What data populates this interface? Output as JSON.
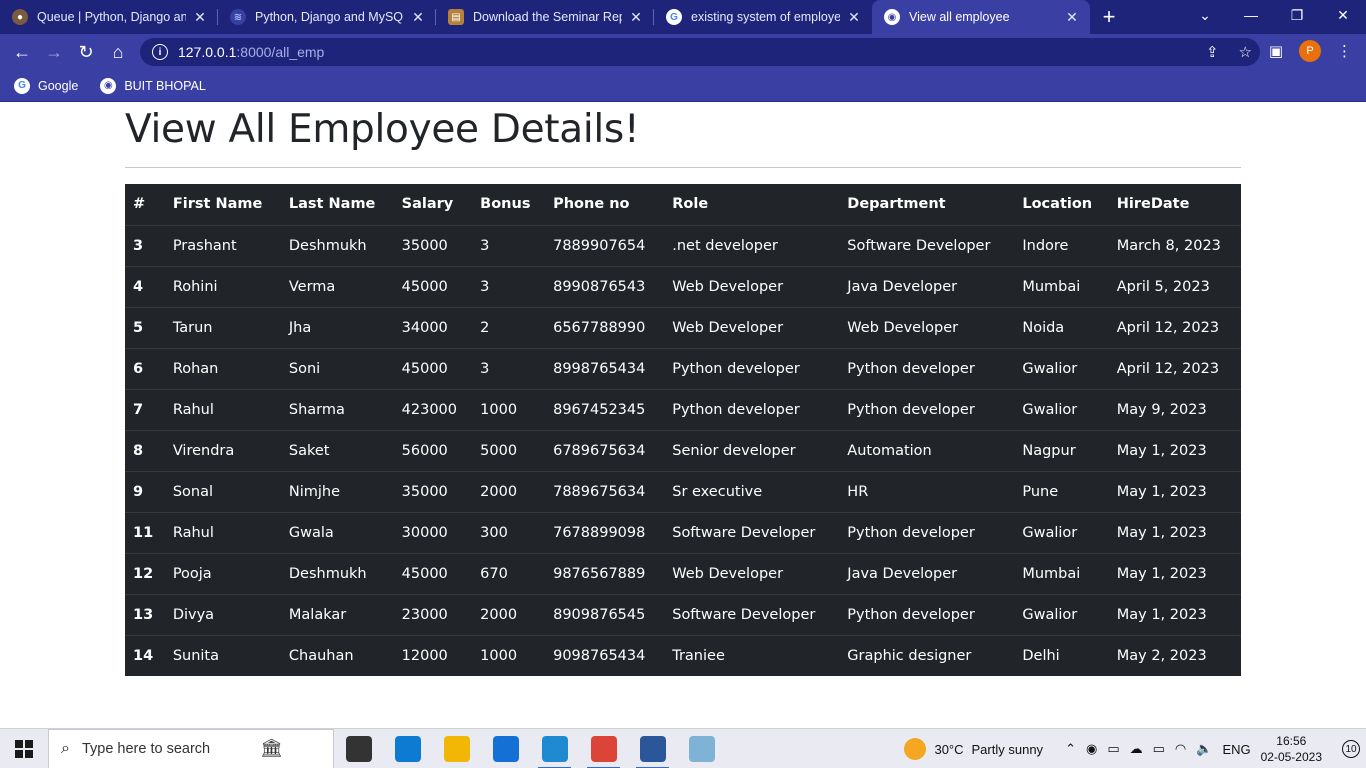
{
  "browser": {
    "tabs": [
      {
        "title": "Queue | Python, Django and",
        "favicon": "anaconda-icon",
        "color": "#5a4a3a",
        "active": false
      },
      {
        "title": "Python, Django and MySQL F",
        "favicon": "stripes-icon",
        "color": "#6c8ebf",
        "active": false
      },
      {
        "title": "Download the Seminar Repor",
        "favicon": "report-icon",
        "color": "#b4823c",
        "active": false
      },
      {
        "title": "existing system of employee",
        "favicon": "google-icon",
        "color": "#ffffff",
        "active": false
      },
      {
        "title": "View all employee",
        "favicon": "globe-icon",
        "color": "#ffffff",
        "active": true
      }
    ],
    "new_tab_label": "+",
    "address": {
      "host": "127.0.0.1",
      "path": ":8000/all_emp"
    },
    "profile_initial": "P",
    "bookmarks": [
      {
        "label": "Google",
        "icon": "google-icon"
      },
      {
        "label": "BUIT BHOPAL",
        "icon": "globe-icon"
      }
    ]
  },
  "page": {
    "heading": "View All Employee Details!"
  },
  "table": {
    "headers": [
      "#",
      "First Name",
      "Last Name",
      "Salary",
      "Bonus",
      "Phone no",
      "Role",
      "Department",
      "Location",
      "HireDate"
    ],
    "rows": [
      [
        "3",
        "Prashant",
        "Deshmukh",
        "35000",
        "3",
        "7889907654",
        ".net developer",
        "Software Developer",
        "Indore",
        "March 8, 2023"
      ],
      [
        "4",
        "Rohini",
        "Verma",
        "45000",
        "3",
        "8990876543",
        "Web Developer",
        "Java Developer",
        "Mumbai",
        "April 5, 2023"
      ],
      [
        "5",
        "Tarun",
        "Jha",
        "34000",
        "2",
        "6567788990",
        "Web Developer",
        "Web Developer",
        "Noida",
        "April 12, 2023"
      ],
      [
        "6",
        "Rohan",
        "Soni",
        "45000",
        "3",
        "8998765434",
        "Python developer",
        "Python developer",
        "Gwalior",
        "April 12, 2023"
      ],
      [
        "7",
        "Rahul",
        "Sharma",
        "423000",
        "1000",
        "8967452345",
        "Python developer",
        "Python developer",
        "Gwalior",
        "May 9, 2023"
      ],
      [
        "8",
        "Virendra",
        "Saket",
        "56000",
        "5000",
        "6789675634",
        "Senior developer",
        "Automation",
        "Nagpur",
        "May 1, 2023"
      ],
      [
        "9",
        "Sonal",
        "Nimjhe",
        "35000",
        "2000",
        "7889675634",
        "Sr executive",
        "HR",
        "Pune",
        "May 1, 2023"
      ],
      [
        "11",
        "Rahul",
        "Gwala",
        "30000",
        "300",
        "7678899098",
        "Software Developer",
        "Python developer",
        "Gwalior",
        "May 1, 2023"
      ],
      [
        "12",
        "Pooja",
        "Deshmukh",
        "45000",
        "670",
        "9876567889",
        "Web Developer",
        "Java Developer",
        "Mumbai",
        "May 1, 2023"
      ],
      [
        "13",
        "Divya",
        "Malakar",
        "23000",
        "2000",
        "8909876545",
        "Software Developer",
        "Python developer",
        "Gwalior",
        "May 1, 2023"
      ],
      [
        "14",
        "Sunita",
        "Chauhan",
        "12000",
        "1000",
        "9098765434",
        "Traniee",
        "Graphic designer",
        "Delhi",
        "May 2, 2023"
      ]
    ]
  },
  "taskbar": {
    "search_placeholder": "Type here to search",
    "apps": [
      {
        "name": "task-view-icon",
        "color": "#333333",
        "open": false
      },
      {
        "name": "edge-icon",
        "color": "#0c7bd1",
        "open": false
      },
      {
        "name": "file-explorer-icon",
        "color": "#f2b705",
        "open": false
      },
      {
        "name": "mail-icon",
        "color": "#1570d6",
        "open": false
      },
      {
        "name": "vscode-icon",
        "color": "#1f8ad2",
        "open": true
      },
      {
        "name": "chrome-icon",
        "color": "#db4437",
        "open": true
      },
      {
        "name": "word-icon",
        "color": "#2b579a",
        "open": true
      },
      {
        "name": "notepad-icon",
        "color": "#7fb3d5",
        "open": false
      }
    ],
    "weather": {
      "temp": "30°C",
      "desc": "Partly sunny"
    },
    "language": "ENG",
    "time": "16:56",
    "date": "02-05-2023",
    "notification_count": "10"
  },
  "colors": {
    "browser_frame": "#1e2479",
    "toolbar": "#3a3fa3",
    "table_bg": "#212529",
    "heading": "#212529"
  }
}
